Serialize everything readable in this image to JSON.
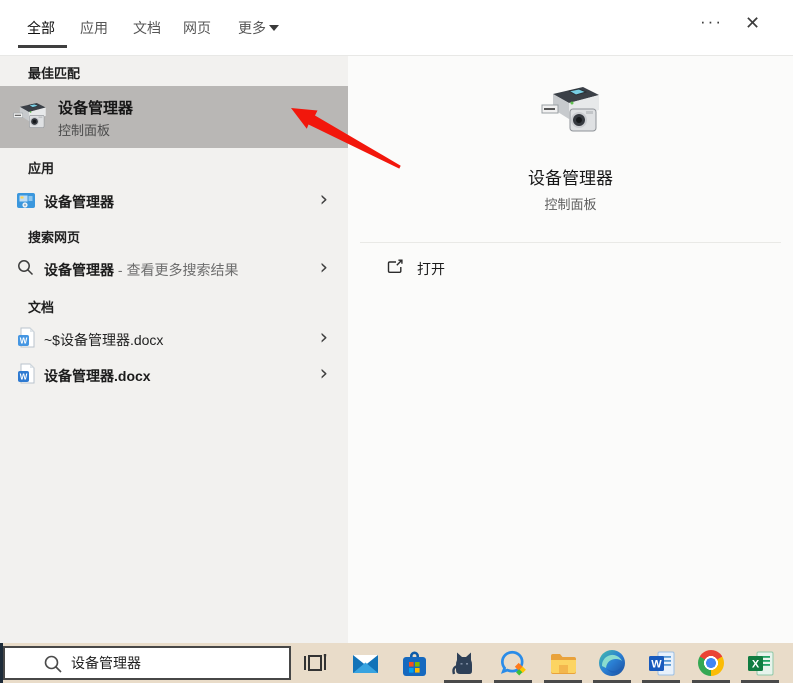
{
  "header": {
    "tabs": [
      {
        "label": "全部",
        "active": true
      },
      {
        "label": "应用",
        "active": false
      },
      {
        "label": "文档",
        "active": false
      },
      {
        "label": "网页",
        "active": false
      },
      {
        "label": "更多",
        "active": false,
        "has_caret": true
      }
    ],
    "ellipsis": "···",
    "close": "✕"
  },
  "best_match": {
    "header": "最佳匹配",
    "item": {
      "title": "设备管理器",
      "subtitle": "控制面板"
    }
  },
  "apps": {
    "header": "应用",
    "item": {
      "label": "设备管理器"
    },
    "chevron": "›"
  },
  "web": {
    "header": "搜索网页",
    "item": {
      "query": "设备管理器",
      "suffix": " - 查看更多搜索结果"
    },
    "chevron": "›"
  },
  "docs": {
    "header": "文档",
    "items": [
      {
        "name": "~$设备管理器.docx"
      },
      {
        "name": "设备管理器.docx"
      }
    ],
    "chevron": "›"
  },
  "preview": {
    "title": "设备管理器",
    "subtitle": "控制面板",
    "open_label": "打开"
  },
  "taskbar": {
    "search_value": "设备管理器",
    "icons": [
      {
        "name": "task-view-icon",
        "running": false
      },
      {
        "name": "mail-icon",
        "running": false
      },
      {
        "name": "store-icon",
        "running": false
      },
      {
        "name": "cat-app-icon",
        "running": true
      },
      {
        "name": "chat-app-icon",
        "running": true
      },
      {
        "name": "file-explorer-icon",
        "running": true
      },
      {
        "name": "edge-icon",
        "running": true
      },
      {
        "name": "word-icon",
        "running": true
      },
      {
        "name": "chrome-icon",
        "running": true
      },
      {
        "name": "excel-icon",
        "running": true
      }
    ]
  },
  "colors": {
    "highlight": "#b9b7b5",
    "panel_left": "#f2f1ef",
    "panel_right": "#fbfbfa",
    "taskbar": "#e9dcc9",
    "arrow_red": "#f2170c",
    "active_underline": "#3f3f3f"
  }
}
